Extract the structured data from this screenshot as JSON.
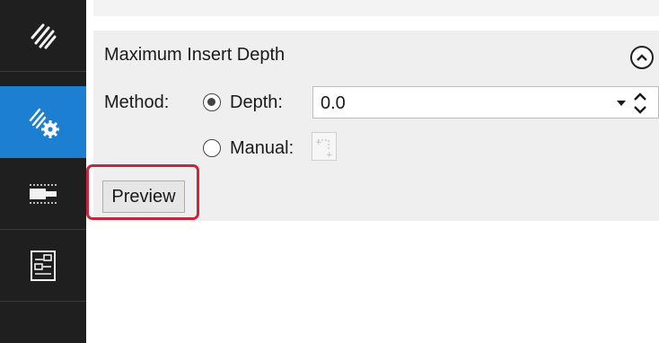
{
  "sidebar": {
    "items": [
      {
        "icon": "stripes-icon",
        "active": false
      },
      {
        "icon": "stripes-gear-icon",
        "active": true
      },
      {
        "icon": "insert-icon",
        "active": false
      },
      {
        "icon": "layout-panel-icon",
        "active": false
      }
    ]
  },
  "panel": {
    "title": "Maximum Insert Depth",
    "method_label": "Method:",
    "depth_option": "Depth:",
    "manual_option": "Manual:",
    "depth_value": "0.0",
    "preview_label": "Preview"
  },
  "colors": {
    "sidebar_bg": "#1f1f1f",
    "active_item": "#1c7fd1",
    "highlight": "#c8263f"
  }
}
